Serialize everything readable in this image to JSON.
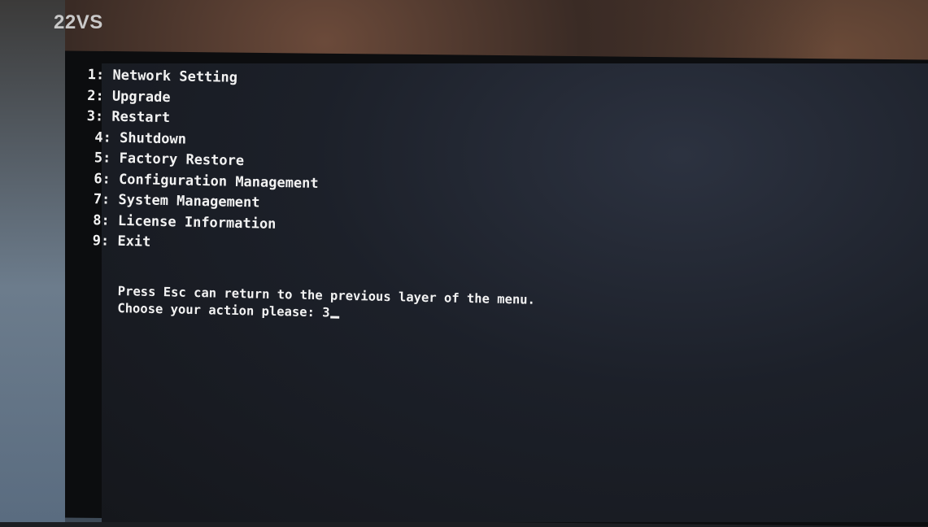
{
  "brand_label": "22VS",
  "menu": {
    "items": [
      {
        "number": "1",
        "label": "Network Setting"
      },
      {
        "number": "2",
        "label": "Upgrade"
      },
      {
        "number": "3",
        "label": "Restart"
      },
      {
        "number": "4",
        "label": "Shutdown"
      },
      {
        "number": "5",
        "label": "Factory Restore"
      },
      {
        "number": "6",
        "label": "Configuration Management"
      },
      {
        "number": "7",
        "label": "System Management"
      },
      {
        "number": "8",
        "label": "License Information"
      },
      {
        "number": "9",
        "label": "Exit"
      }
    ]
  },
  "hint_text": "Press Esc can return to the previous layer of the menu.",
  "prompt": {
    "label": "Choose your action please: ",
    "value": "3"
  }
}
